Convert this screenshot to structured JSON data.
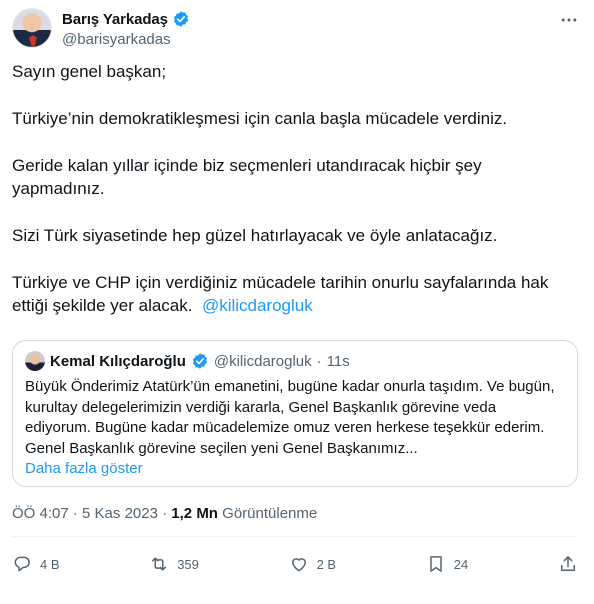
{
  "author": {
    "display_name": "Barış Yarkadaş",
    "handle": "@barisyarkadas",
    "verified_icon": "verified-badge-icon"
  },
  "tweet": {
    "paragraphs": [
      "Sayın genel başkan;",
      "Türkiye’nin demokratikleşmesi için canla başla mücadele verdiniz.",
      "Geride kalan yıllar içinde biz seçmenleri utandıracak hiçbir şey yapmadınız.",
      "Sizi Türk siyasetinde hep güzel hatırlayacak ve öyle anlatacağız.",
      "Türkiye ve CHP için verdiğiniz mücadele tarihin onurlu sayfalarında hak ettiği şekilde yer alacak."
    ],
    "mention": "@kilicdarogluk"
  },
  "quote": {
    "display_name": "Kemal Kılıçdaroğlu",
    "handle": "@kilicdarogluk",
    "separator": "·",
    "time": "11s",
    "text": "Büyük Önderimiz Atatürk’ün emanetini, bugüne kadar onurla taşıdım. Ve bugün, kurultay delegelerimizin verdiği kararla, Genel Başkanlık görevine veda ediyorum. Bugüne kadar mücadelemize omuz veren herkese teşekkür ederim. Genel Başkanlık görevine seçilen yeni Genel Başkanımız...",
    "show_more": "Daha fazla göster"
  },
  "meta": {
    "time": "ÖÖ 4:07",
    "date": "5 Kas 2023",
    "views_count": "1,2 Mn",
    "views_label": "Görüntülenme"
  },
  "actions": {
    "replies": "4 B",
    "retweets": "359",
    "likes": "2 B",
    "bookmarks": "24"
  },
  "colors": {
    "accent": "#1d9bf0",
    "text": "#0f1419",
    "secondary": "#536471",
    "border": "#cfd9de"
  }
}
